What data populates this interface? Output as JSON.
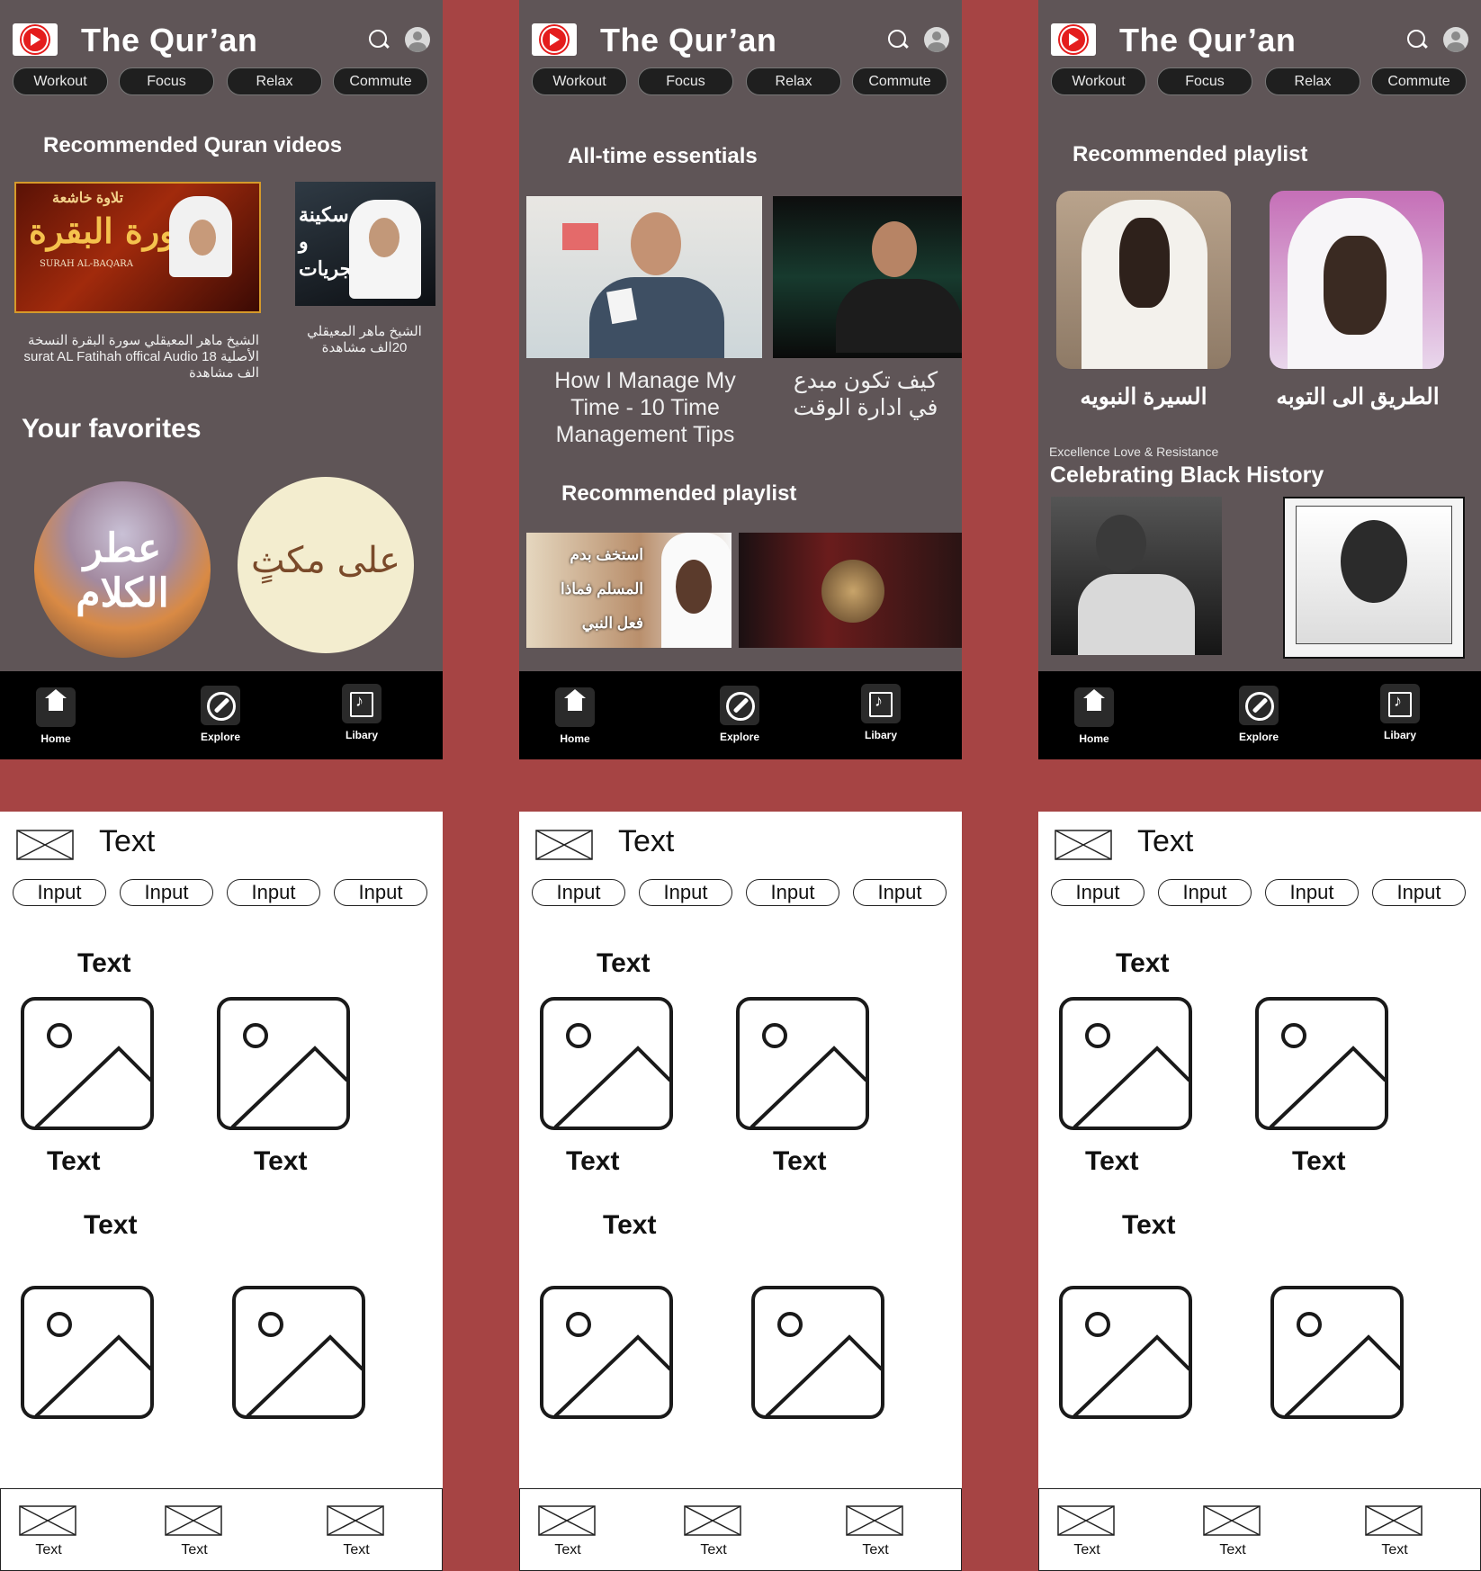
{
  "header": {
    "title": "The Qur’an",
    "chips": [
      "Workout",
      "Focus",
      "Relax",
      "Commute"
    ]
  },
  "screen1": {
    "section1_title": "Recommended Quran videos",
    "video1_caption": "الشيخ ماهر المعيقلي سورة البقرة النسخة الأصلية surat AL Fatihah offical Audio 18 الف مشاهدة",
    "video2_caption": "الشيخ ماهر المعيقلي 20الف مشاهدة",
    "thumb1_text": "سورة البقرة",
    "thumb1_sub": "SURAH AL-BAQARA",
    "thumb1_top": "تلاوة خاشعة",
    "thumb2_text": "سكينة و فجريات",
    "section2_title": "Your favorites",
    "fav1_text": "عطر الكلام",
    "fav2_text": "على مكثٍ"
  },
  "screen2": {
    "section1_title": "All-time essentials",
    "video1_caption": "How I Manage My Time - 10 Time Management Tips",
    "video2_caption": "كيف تكون مبدع في ادارة الوقت",
    "section2_title": "Recommended playlist",
    "thumb3_text": "استخف بدم المسلم فماذا فعل النبي"
  },
  "screen3": {
    "section1_title": "Recommended playlist",
    "playlist1_caption": "السيرة النبويه",
    "playlist2_caption": "الطريق الى التوبه",
    "eyebrow": "Excellence Love & Resistance",
    "section2_title": "Celebrating Black History"
  },
  "nav": {
    "home": "Home",
    "explore": "Explore",
    "library": "Libary"
  },
  "wireframe": {
    "title": "Text",
    "inputs": [
      "Input",
      "Input",
      "Input",
      "Input"
    ],
    "section1": "Text",
    "item1": "Text",
    "item2": "Text",
    "section2": "Text",
    "nav": [
      "Text",
      "Text",
      "Text"
    ]
  },
  "colors": {
    "background": "#a64444",
    "phone_bg": "#5f5557",
    "nav_bg": "#000000",
    "brand_red": "#e41d1d"
  }
}
